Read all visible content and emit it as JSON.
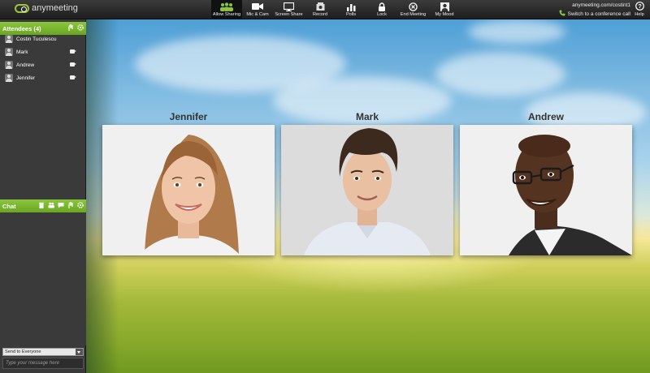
{
  "topbar": {
    "logo_text": "anymeeting",
    "tools": [
      {
        "label": "Allow Sharing",
        "icon": "people-icon",
        "active": true
      },
      {
        "label": "Mic & Cam",
        "icon": "camera-icon"
      },
      {
        "label": "Screen Share",
        "icon": "monitor-icon"
      },
      {
        "label": "Record",
        "icon": "record-icon"
      },
      {
        "label": "Polls",
        "icon": "bar-chart-icon"
      },
      {
        "label": "Lock",
        "icon": "lock-icon"
      },
      {
        "label": "End Meeting",
        "icon": "close-circle-icon"
      },
      {
        "label": "My Mood",
        "icon": "person-icon"
      }
    ],
    "meeting_url": "anymeeting.com/costint1",
    "conference_call_label": "Switch to a conference call",
    "help_label": "Help"
  },
  "attendees": {
    "title": "Attendees (4)",
    "list": [
      {
        "name": "Costin Tuculescu",
        "cam": false
      },
      {
        "name": "Mark",
        "cam": true
      },
      {
        "name": "Andrew",
        "cam": true
      },
      {
        "name": "Jennifer",
        "cam": true
      }
    ]
  },
  "chat": {
    "title": "Chat",
    "send_to": "Send to Everyone",
    "input_placeholder": "Type your message here"
  },
  "videos": [
    {
      "name": "Jennifer"
    },
    {
      "name": "Mark"
    },
    {
      "name": "Andrew"
    }
  ],
  "colors": {
    "accent_green": "#7ab733",
    "topbar": "#2b2b2b",
    "panel": "#3a3a3a"
  }
}
